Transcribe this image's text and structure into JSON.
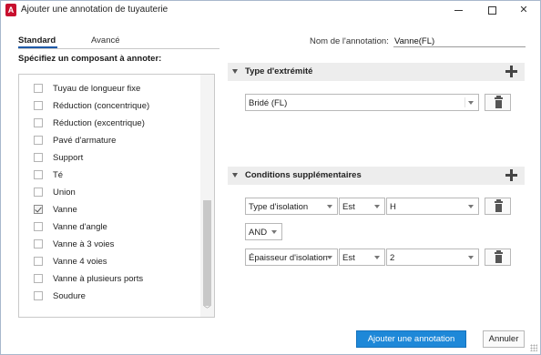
{
  "window": {
    "title": "Ajouter une annotation de tuyauterie",
    "icon_letter": "A",
    "brand_color": "#c8102e"
  },
  "tabs": {
    "standard": "Standard",
    "advanced": "Avancé"
  },
  "annotation_name": {
    "label": "Nom de l'annotation:",
    "value": "Vanne(FL)"
  },
  "component_section": {
    "label": "Spécifiez un composant à annoter:",
    "items": [
      {
        "label": "Tuyau de longueur fixe",
        "checked": false
      },
      {
        "label": "Réduction (concentrique)",
        "checked": false
      },
      {
        "label": "Réduction (excentrique)",
        "checked": false
      },
      {
        "label": "Pavé d'armature",
        "checked": false
      },
      {
        "label": "Support",
        "checked": false
      },
      {
        "label": "Té",
        "checked": false
      },
      {
        "label": "Union",
        "checked": false
      },
      {
        "label": "Vanne",
        "checked": true
      },
      {
        "label": "Vanne d'angle",
        "checked": false
      },
      {
        "label": "Vanne à 3 voies",
        "checked": false
      },
      {
        "label": "Vanne 4 voies",
        "checked": false
      },
      {
        "label": "Vanne à plusieurs ports",
        "checked": false
      },
      {
        "label": "Soudure",
        "checked": false
      }
    ]
  },
  "end_type": {
    "title": "Type d'extrémité",
    "value": "Bridé (FL)"
  },
  "conditions": {
    "title": "Conditions supplémentaires",
    "row1": {
      "property": "Type d'isolation",
      "operator": "Est",
      "value": "H"
    },
    "logic": "AND",
    "row2": {
      "property": "Épaisseur d'isolation",
      "operator": "Est",
      "value": "2"
    }
  },
  "footer": {
    "primary_label": "Ajouter une annotation",
    "cancel_label": "Annuler"
  },
  "colors": {
    "accent": "#1e88d8",
    "tab_underline": "#1e5aa8",
    "section_bg": "#ededed"
  }
}
